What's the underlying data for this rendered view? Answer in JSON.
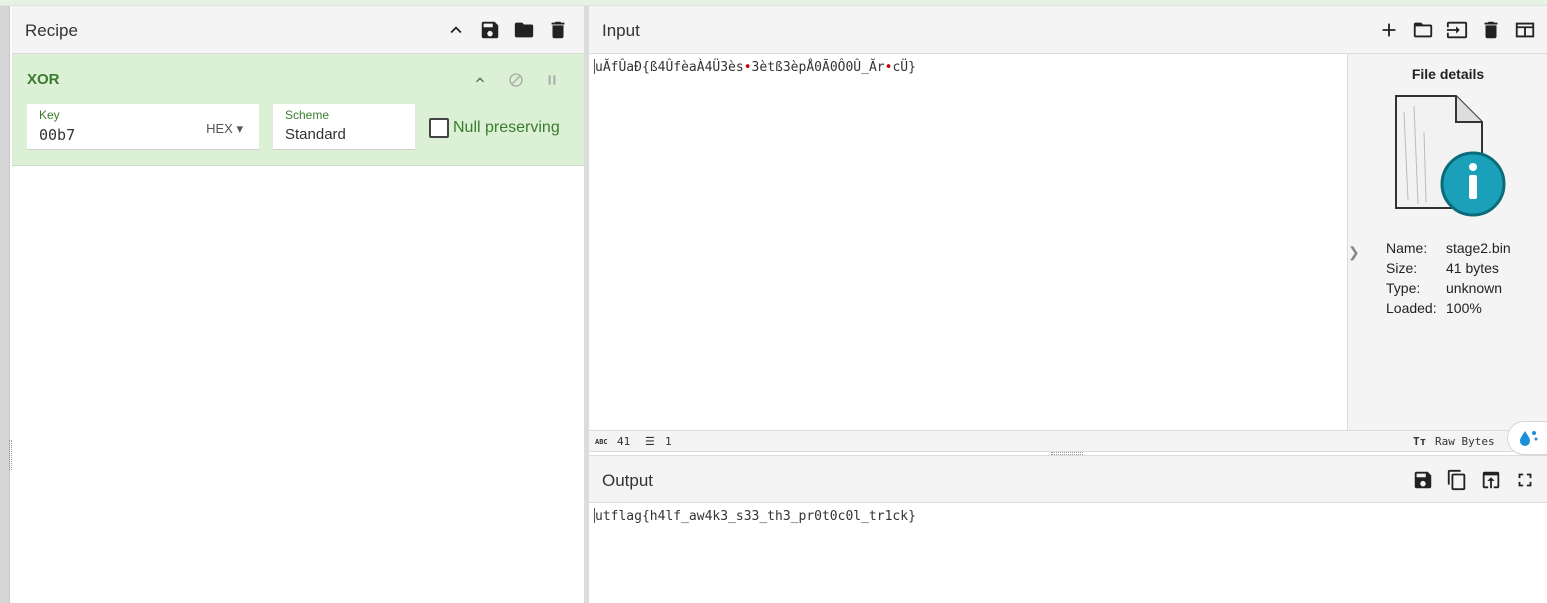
{
  "recipe": {
    "title": "Recipe",
    "operation": {
      "name": "XOR",
      "key_label": "Key",
      "key_value": "00b7",
      "key_format": "HEX",
      "scheme_label": "Scheme",
      "scheme_value": "Standard",
      "null_preserving_label": "Null preserving",
      "null_preserving_checked": false
    }
  },
  "input": {
    "title": "Input",
    "text_part1": "uĂfÛaÐ{ß4ÛfèaÀ4Ü3ès",
    "text_part2": "3ètß3èpÅ0Ã0Ô0Û_Ăr",
    "text_part3": "cÜ}",
    "separator_glyph": "•",
    "separator_color": "#cc0000",
    "status_chars_label": "ABC",
    "status_chars": "41",
    "status_lines": "1",
    "status_encoding": "Raw Bytes"
  },
  "file_details": {
    "title": "File details",
    "name_label": "Name:",
    "name_value": "stage2.bin",
    "size_label": "Size:",
    "size_value": "41 bytes",
    "type_label": "Type:",
    "type_value": "unknown",
    "loaded_label": "Loaded:",
    "loaded_value": "100%"
  },
  "output": {
    "title": "Output",
    "text": "utflag{h4lf_aw4k3_s33_th3_pr0t0c0l_tr1ck}"
  },
  "colors": {
    "accent_green": "#3a7d2e",
    "op_background": "#dbf0d5",
    "info_teal": "#1aa0b8"
  }
}
